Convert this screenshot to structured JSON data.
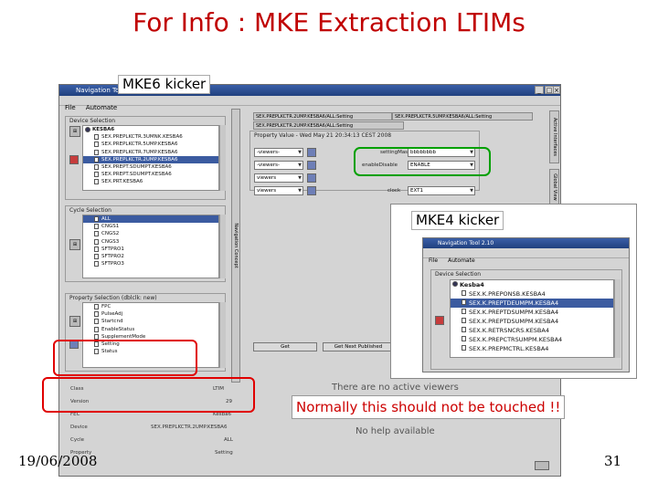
{
  "slide": {
    "title": "For Info : MKE Extraction LTIMs",
    "kicker6": "MKE6 kicker",
    "kicker4": "MKE4 kicker",
    "note": "Normally this should not be touched !!",
    "date": "19/06/2008",
    "page_number": "31"
  },
  "window": {
    "title": "Navigation Tool",
    "menu": [
      "File",
      "Automate"
    ]
  },
  "device_selection": {
    "title": "Device Selection",
    "root": "KESBA6",
    "items": [
      "SEX.PREPLKCTR.3UMNK.KESBA6",
      "SEX.PREPLKCTR.5UMP.KESBA6",
      "SEX.PREPLKCTR.7UMP.KESBA6",
      "SEX.PREPLKCTR.2UMP.KESBA6",
      "SEX.PREPT.SDUMPT.KESBA6",
      "SEX.PREPT.SDUMPT.KESBA6",
      "SEX.PRT.KESBA6"
    ],
    "selected_index": 3
  },
  "cycle_selection": {
    "title": "Cycle Selection",
    "items": [
      "ALL",
      "CNGS1",
      "CNGS2",
      "CNGS3",
      "SFTPRO1",
      "SFTPRO2",
      "SFTPRO3"
    ]
  },
  "property_selection": {
    "title": "Property Selection (dblclk: new)",
    "items": [
      "FPC",
      "PulseAdj",
      "Startcnd",
      "EnableStatus",
      "SupplementMode",
      "Setting",
      "Status"
    ]
  },
  "info": {
    "rows": [
      {
        "key": "Class",
        "value": "LTIM"
      },
      {
        "key": "Version",
        "value": "29"
      },
      {
        "key": "FEC",
        "value": "Kesba6"
      },
      {
        "key": "Device",
        "value": "SEX.PREPLKCTR.2UMP.KESBA6"
      },
      {
        "key": "Cycle",
        "value": "ALL"
      },
      {
        "key": "Property",
        "value": "Setting"
      }
    ]
  },
  "tabs": {
    "top": [
      "SEX.PREPLKCTR.2UMP.KESBA6/ALL:Setting",
      "SEX.PREPLKCTR.5UMP.KESBA6/ALL:Setting"
    ],
    "second": "SEX.PREPLKCTR.2UMP.KESBA6/ALL:Setting",
    "vertical_nav": "Navigation Concept",
    "right_tabs": [
      "Active Interfaces",
      "Global View"
    ]
  },
  "property_value": {
    "title": "Property Value - Wed May 21 20:34:13 CEST 2008",
    "viewers": [
      "-viewers-",
      "-viewers-",
      "viewers",
      "viewers"
    ],
    "fields": [
      {
        "label": "settingMask",
        "value": "bbbbbbbb"
      },
      {
        "label": "enableDisable",
        "value": "ENABLE"
      },
      {
        "label": "clock",
        "value": "EXT1"
      }
    ],
    "get_label": "Get",
    "get_next_label": "Get Next Published"
  },
  "status": {
    "no_viewers": "There are no active viewers",
    "no_help": "No help available"
  },
  "inset": {
    "title": "Navigation Tool 2.10",
    "menu": [
      "File",
      "Automate"
    ],
    "device_title": "Device Selection",
    "root": "Kesba4",
    "items": [
      "SEX.K.PREPONSB.KESBA4",
      "SEX.K.PREPTDEUMPM.KESBA4",
      "SEX.K.PREPTDSUMPM.KESBA4",
      "SEX.K.PREPTDSUMPM.KESBA4",
      "SEX.K.RETRSNCRS.KESBA4",
      "SEX.K.PREPCTRSUMPM.KESBA4",
      "SEX.K.PREPMCTRL.KESBA4"
    ],
    "selected_index": 1
  },
  "colors": {
    "title_red": "#c00000",
    "highlight_red": "#e00000",
    "highlight_green": "#00a000",
    "selection_blue": "#3b5ba0"
  }
}
